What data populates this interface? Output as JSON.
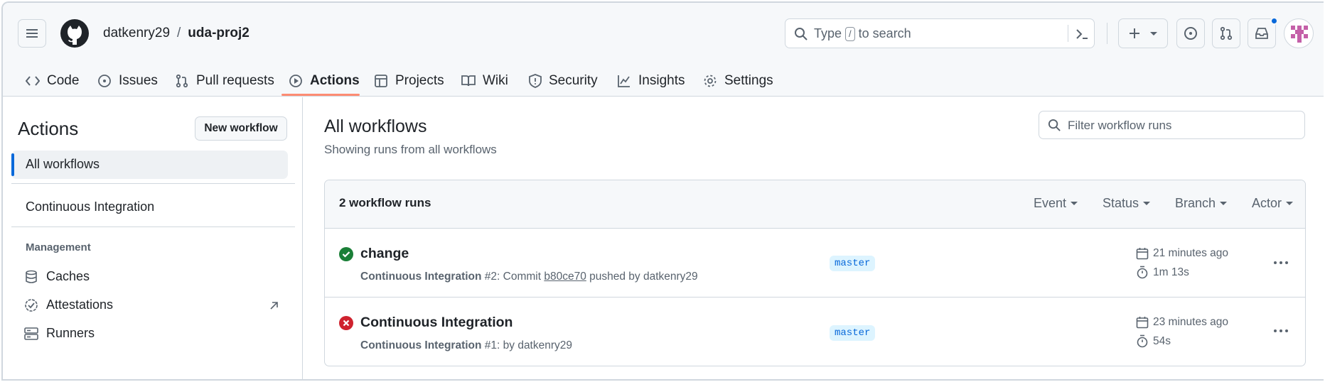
{
  "header": {
    "owner": "datkenry29",
    "separator": "/",
    "repo": "uda-proj2",
    "search_placeholder_pre": "Type",
    "search_key": "/",
    "search_placeholder_post": "to search"
  },
  "tabs": [
    {
      "label": "Code",
      "icon": "code-icon"
    },
    {
      "label": "Issues",
      "icon": "issue-icon"
    },
    {
      "label": "Pull requests",
      "icon": "pull-request-icon"
    },
    {
      "label": "Actions",
      "icon": "play-icon",
      "active": true
    },
    {
      "label": "Projects",
      "icon": "table-icon"
    },
    {
      "label": "Wiki",
      "icon": "book-icon"
    },
    {
      "label": "Security",
      "icon": "shield-icon"
    },
    {
      "label": "Insights",
      "icon": "graph-icon"
    },
    {
      "label": "Settings",
      "icon": "gear-icon"
    }
  ],
  "sidebar": {
    "title": "Actions",
    "new_workflow": "New workflow",
    "all_workflows": "All workflows",
    "workflows": [
      "Continuous Integration"
    ],
    "management_heading": "Management",
    "management_items": [
      {
        "label": "Caches",
        "icon": "database-icon"
      },
      {
        "label": "Attestations",
        "icon": "verified-icon"
      },
      {
        "label": "Runners",
        "icon": "server-icon"
      }
    ]
  },
  "main": {
    "title": "All workflows",
    "subtitle": "Showing runs from all workflows",
    "filter_placeholder": "Filter workflow runs",
    "runs_count": "2 workflow runs",
    "filters": [
      "Event",
      "Status",
      "Branch",
      "Actor"
    ],
    "runs": [
      {
        "title": "change",
        "status": "success",
        "workflow": "Continuous Integration",
        "detail_pre": " #2: Commit ",
        "commit": "b80ce70",
        "detail_post": " pushed by datkenry29",
        "branch": "master",
        "time_ago": "21 minutes ago",
        "duration": "1m 13s"
      },
      {
        "title": "Continuous Integration",
        "status": "failure",
        "workflow": "Continuous Integration",
        "detail_pre": " #1: by datkenry29",
        "commit": "",
        "detail_post": "",
        "branch": "master",
        "time_ago": "23 minutes ago",
        "duration": "54s"
      }
    ]
  },
  "colors": {
    "success": "#1a7f37",
    "failure": "#cf222e",
    "accent": "#0969da",
    "tab_underline": "#fd8c73",
    "notification_dot": "#0969da"
  }
}
